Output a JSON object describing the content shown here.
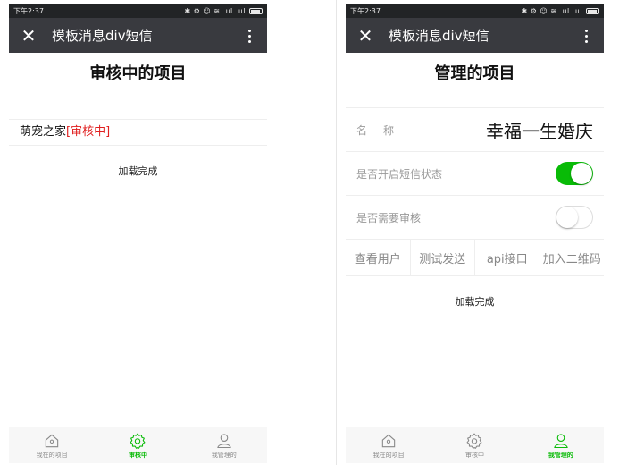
{
  "colors": {
    "accent": "#09bb07",
    "title_bar": "#393a3f",
    "status_bar": "#222426",
    "pending_status": "#e02020"
  },
  "status_bar": {
    "time": "下午2:37",
    "icons": "... ✱ ⚙ ☺ ≋ .ııl .ııl"
  },
  "title_bar": {
    "title": "模板消息div短信",
    "close_icon": "✕"
  },
  "left": {
    "heading": "审核中的项目",
    "project": {
      "name": "萌宠之家",
      "status": "[审核中]"
    },
    "load_text": "加载完成"
  },
  "right": {
    "heading": "管理的项目",
    "name_label": "名称",
    "name_value": "幸福一生婚庆",
    "sms_label": "是否开启短信状态",
    "sms_enabled": true,
    "review_label": "是否需要审核",
    "review_enabled": false,
    "actions": [
      "查看用户",
      "测试发送",
      "api接口",
      "加入二维码"
    ],
    "load_text": "加载完成"
  },
  "tabs": [
    {
      "label": "我在的项目",
      "icon": "home-icon"
    },
    {
      "label": "审核中",
      "icon": "gear-icon"
    },
    {
      "label": "我管理的",
      "icon": "person-icon"
    }
  ],
  "left_active_tab": 1,
  "right_active_tab": 2
}
